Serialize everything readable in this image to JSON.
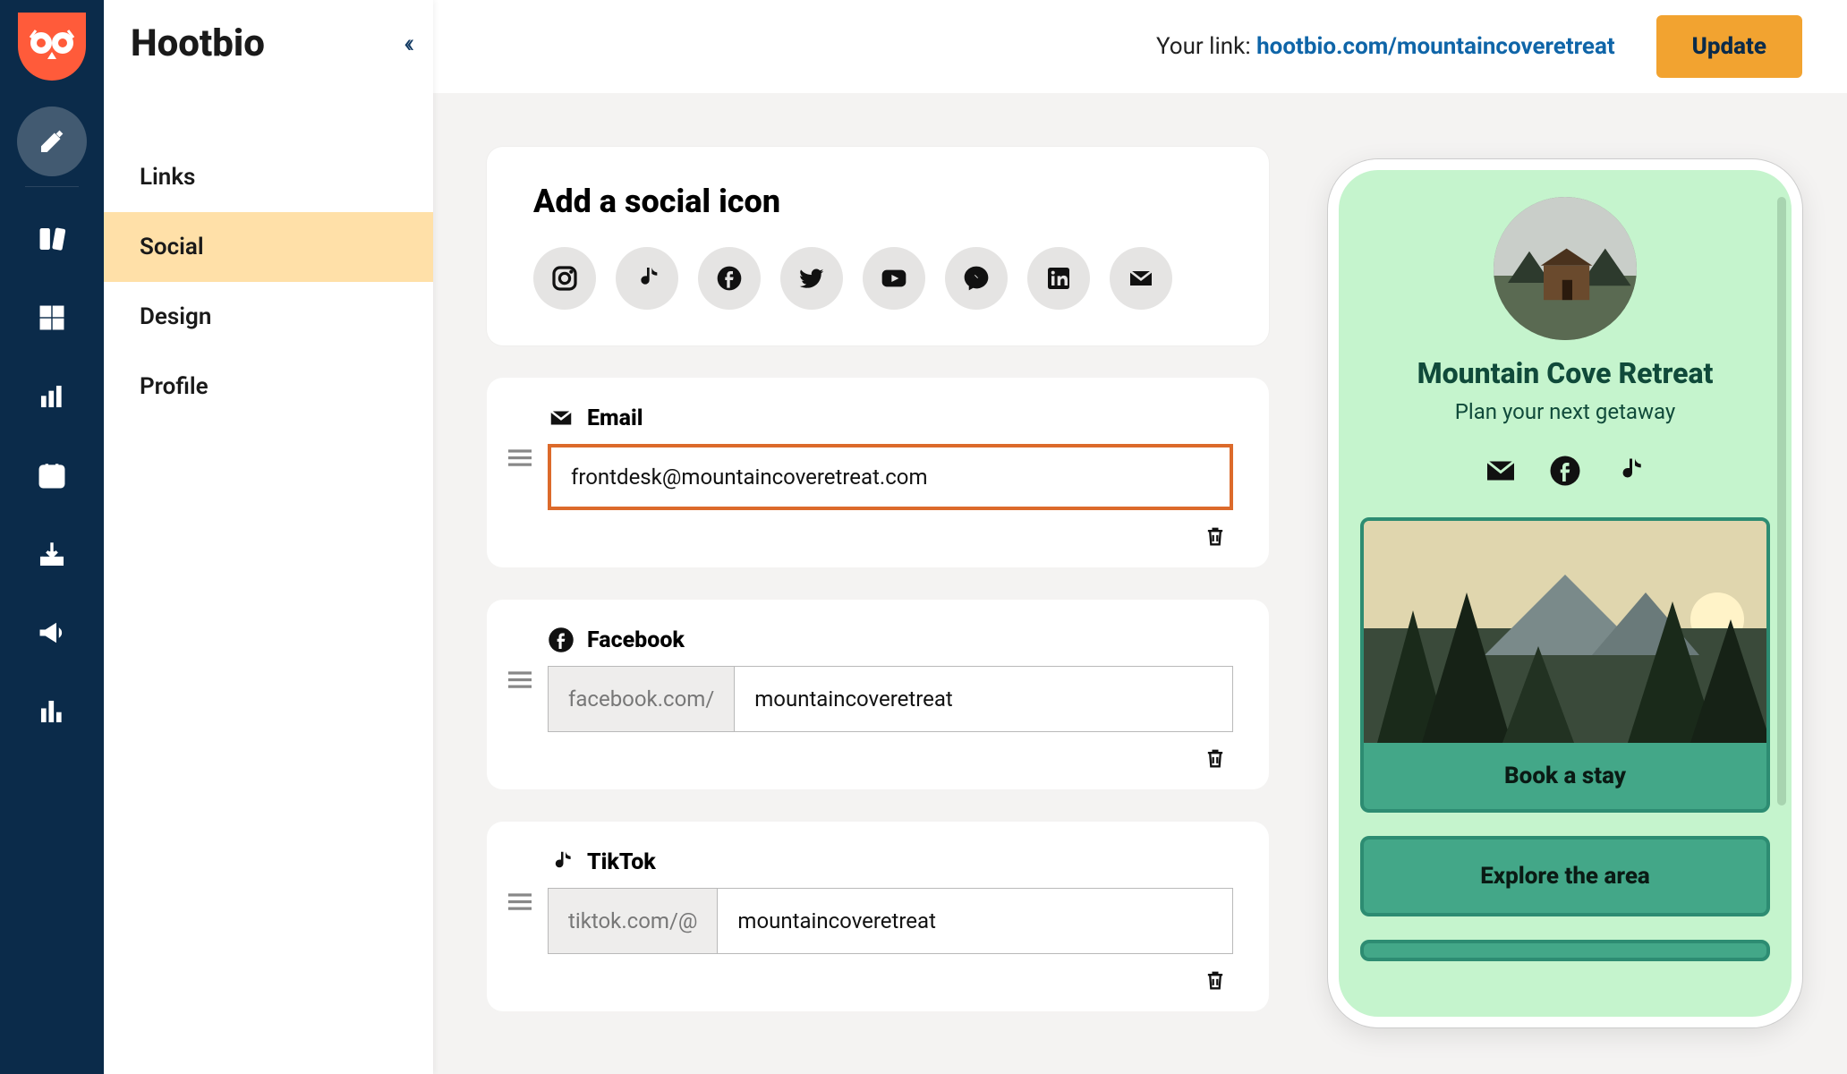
{
  "brand": "Hootbio",
  "sidebar": {
    "items": [
      "Links",
      "Social",
      "Design",
      "Profile"
    ],
    "activeIndex": 1
  },
  "topbar": {
    "linkLabel": "Your link:",
    "linkUrl": "hootbio.com/mountaincoveretreat",
    "update": "Update"
  },
  "addSocial": {
    "title": "Add a social icon",
    "picks": [
      "instagram",
      "tiktok",
      "facebook",
      "twitter",
      "youtube",
      "messenger",
      "linkedin",
      "email"
    ]
  },
  "entries": [
    {
      "type": "Email",
      "icon": "email",
      "prefix": "",
      "value": "frontdesk@mountaincoveretreat.com",
      "focused": true
    },
    {
      "type": "Facebook",
      "icon": "facebook",
      "prefix": "facebook.com/",
      "value": "mountaincoveretreat",
      "focused": false
    },
    {
      "type": "TikTok",
      "icon": "tiktok",
      "prefix": "tiktok.com/@",
      "value": "mountaincoveretreat",
      "focused": false
    }
  ],
  "preview": {
    "title": "Mountain Cove Retreat",
    "subtitle": "Plan your next getaway",
    "socials": [
      "email",
      "facebook",
      "tiktok"
    ],
    "linkButtons": [
      "Book a stay",
      "Explore the area"
    ]
  }
}
